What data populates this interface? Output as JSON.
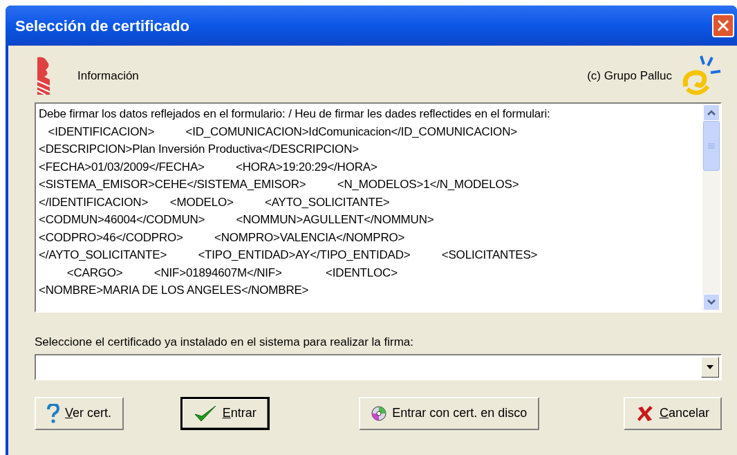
{
  "window": {
    "title": "Selección de certificado"
  },
  "header": {
    "label": "Información",
    "copyright": "(c) Grupo Palluc"
  },
  "text_area": {
    "lines": [
      "Debe firmar los datos reflejados en el formulario: / Heu de firmar les dades reflectides en el formulari:",
      "   <IDENTIFICACION>          <ID_COMUNICACION>IdComunicacion</ID_COMUNICACION>",
      "<DESCRIPCION>Plan Inversión Productiva</DESCRIPCION>",
      "<FECHA>01/03/2009</FECHA>          <HORA>19:20:29</HORA>",
      "<SISTEMA_EMISOR>CEHE</SISTEMA_EMISOR>          <N_MODELOS>1</N_MODELOS>",
      "</IDENTIFICACION>       <MODELO>          <AYTO_SOLICITANTE>",
      "<CODMUN>46004</CODMUN>          <NOMMUN>AGULLENT</NOMMUN>",
      "<CODPRO>46</CODPRO>          <NOMPRO>VALENCIA</NOMPRO>",
      "</AYTO_SOLICITANTE>          <TIPO_ENTIDAD>AY</TIPO_ENTIDAD>          <SOLICITANTES>",
      "         <CARGO>          <NIF>01894607M</NIF>              <IDENTLOC>",
      "<NOMBRE>MARIA DE LOS ANGELES</NOMBRE>"
    ]
  },
  "certificate": {
    "label": "Seleccione el certificado ya instalado en el sistema para realizar la firma:"
  },
  "buttons": [
    {
      "kind": "help",
      "accel": "V",
      "rest": "er cert.",
      "default": false
    },
    {
      "kind": "ok",
      "accel": "E",
      "rest": "ntrar",
      "default": true
    },
    {
      "kind": "disk",
      "rest": "Entrar con cert. en disco",
      "default": false
    },
    {
      "kind": "cancel",
      "accel": "C",
      "rest": "ancelar",
      "default": false
    }
  ]
}
